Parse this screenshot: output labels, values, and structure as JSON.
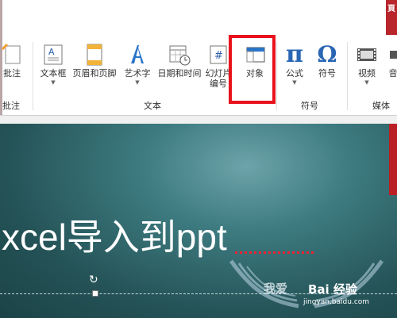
{
  "ribbon": {
    "partial_left": {
      "label": "批注"
    },
    "buttons": {
      "textbox": "文本框",
      "header_footer": "页眉和页脚",
      "wordart": "艺术字",
      "datetime": "日期和时间",
      "slide_number_l1": "幻灯片",
      "slide_number_l2": "编号",
      "object": "对象",
      "equation": "公式",
      "symbol": "符号",
      "video": "视频",
      "audio_partial": "音"
    },
    "groups": {
      "comments": "批注",
      "text": "文本",
      "symbols": "符号",
      "media": "媒体"
    },
    "icon_glyphs": {
      "equation": "π",
      "symbol": "Ω",
      "slide_number": "#"
    }
  },
  "slide": {
    "title": "xcel导入到ppt"
  },
  "watermark": {
    "text": "我爱",
    "brand": "Bai 经验",
    "url": "jingyan.baidu.com"
  },
  "tab_edge_char": "頁",
  "colors": {
    "highlight": "#e8131c",
    "slide_dark": "#1b4347",
    "slide_light": "#6da3aa",
    "accent_red": "#b8252b"
  }
}
